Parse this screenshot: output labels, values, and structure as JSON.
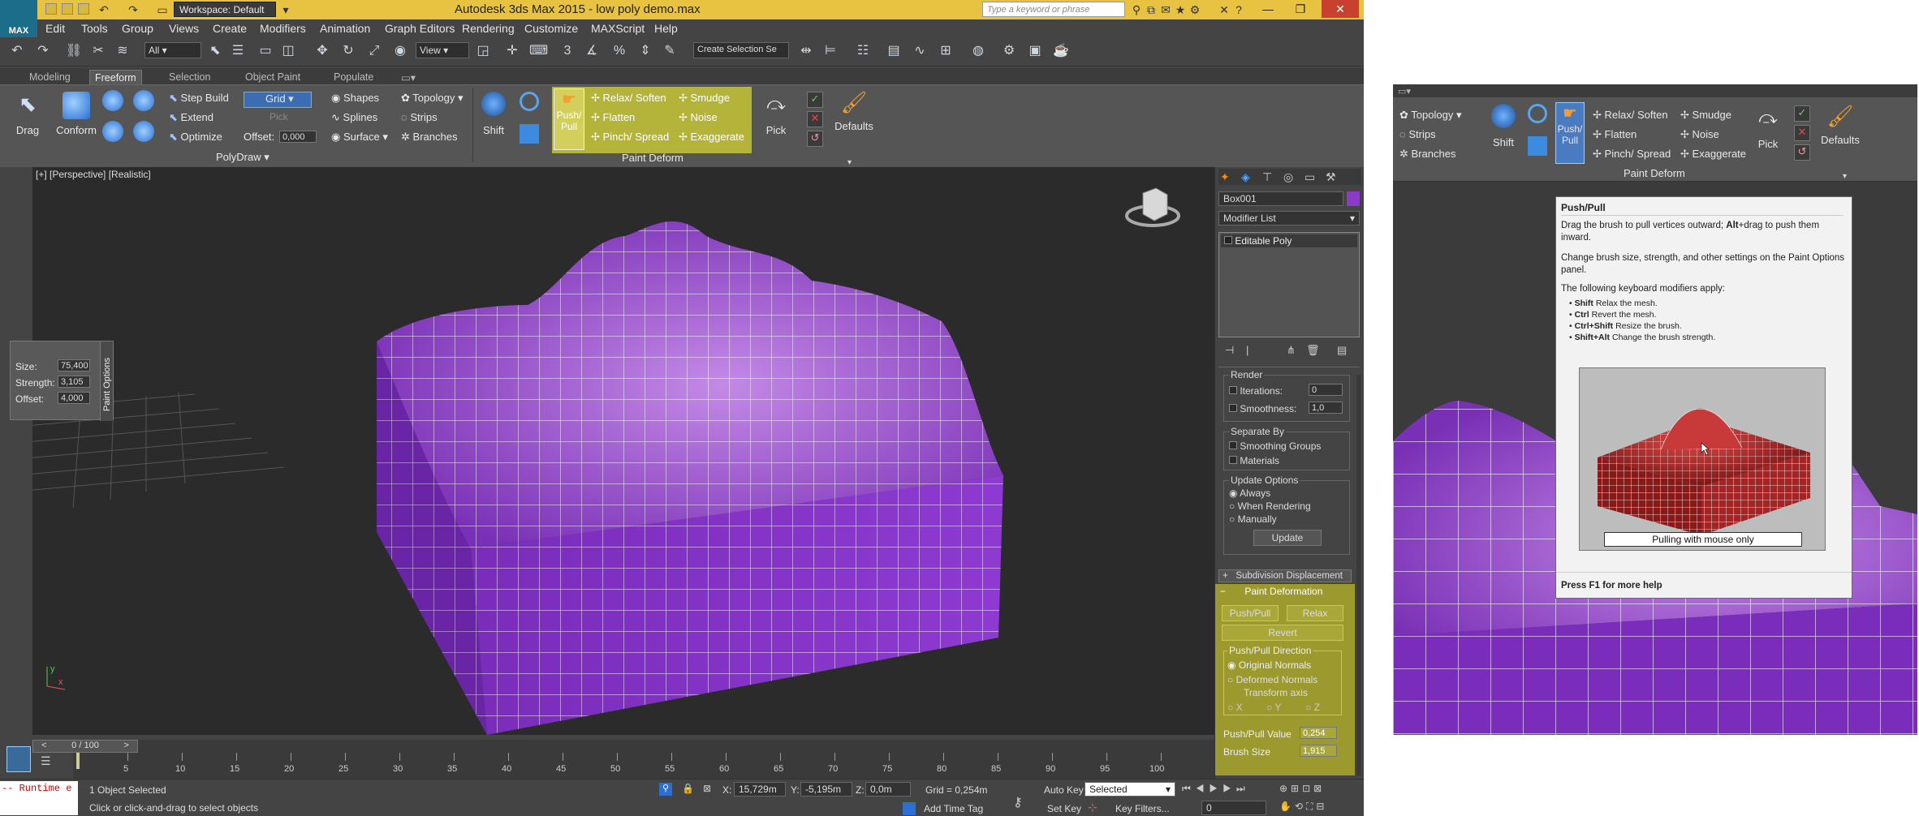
{
  "window": {
    "title": "Autodesk 3ds Max  2015  -  low poly demo.max",
    "app_logo": "MAX",
    "workspace": "Workspace: Default",
    "search_placeholder": "Type a keyword or phrase"
  },
  "menu": [
    "Edit",
    "Tools",
    "Group",
    "Views",
    "Create",
    "Modifiers",
    "Animation",
    "Graph Editors",
    "Rendering",
    "Customize",
    "MAXScript",
    "Help"
  ],
  "toolbar": {
    "filter": "All",
    "ref_coord": "View",
    "selection_set": "Create Selection Se"
  },
  "ribbon_tabs": [
    "Modeling",
    "Freeform",
    "Selection",
    "Object Paint",
    "Populate"
  ],
  "ribbon_active_tab": "Freeform",
  "ribbon": {
    "drag": "Drag",
    "conform": "Conform",
    "step_build": "Step Build",
    "extend": "Extend",
    "optimize": "Optimize",
    "grid": "Grid",
    "pick": "Pick",
    "offset_label": "Offset:",
    "offset_value": "0,000",
    "shapes": "Shapes",
    "splines": "Splines",
    "surface": "Surface",
    "topology": "Topology",
    "strips": "Strips",
    "branches": "Branches",
    "polydraw": "PolyDraw",
    "shift": "Shift",
    "push_pull": "Push/ Pull",
    "relax_soften": "Relax/ Soften",
    "flatten": "Flatten",
    "pinch_spread": "Pinch/ Spread",
    "smudge": "Smudge",
    "noise": "Noise",
    "exaggerate": "Exaggerate",
    "pick2": "Pick",
    "defaults": "Defaults",
    "paint_deform": "Paint Deform"
  },
  "viewport": {
    "label": "[+] [Perspective] [Realistic]",
    "mesh_color": "#8a3cc6",
    "axis_y": "y",
    "axis_x": "x"
  },
  "paint_options": {
    "title": "Paint Options",
    "size_label": "Size:",
    "size_value": "75,400",
    "strength_label": "Strength:",
    "strength_value": "3,105",
    "offset_label": "Offset:",
    "offset_value": "4,000"
  },
  "command_panel": {
    "object_name": "Box001",
    "object_color": "#8a3cc6",
    "modifier_list": "Modifier List",
    "stack_item": "Editable Poly",
    "render": "Render",
    "iterations_label": "Iterations:",
    "iterations_value": "0",
    "smoothness_label": "Smoothness:",
    "smoothness_value": "1,0",
    "separate_by": "Separate By",
    "smoothing_groups": "Smoothing Groups",
    "materials": "Materials",
    "update_options": "Update Options",
    "always": "Always",
    "when_rendering": "When Rendering",
    "manually": "Manually",
    "update": "Update",
    "subdiv_disp": "Subdivision Displacement",
    "paint_deformation": "Paint Deformation",
    "push_pull": "Push/Pull",
    "relax": "Relax",
    "revert": "Revert",
    "pp_direction": "Push/Pull Direction",
    "original_normals": "Original Normals",
    "deformed_normals": "Deformed Normals",
    "transform_axis": "Transform axis",
    "ax_x": "X",
    "ax_y": "Y",
    "ax_z": "Z",
    "pp_value_label": "Push/Pull Value",
    "pp_value": "0,254",
    "brush_size_label": "Brush Size",
    "brush_size": "1,915"
  },
  "timeline": {
    "frame": "0 / 100",
    "ticks": [
      "5",
      "10",
      "15",
      "20",
      "25",
      "30",
      "35",
      "40",
      "45",
      "50",
      "55",
      "60",
      "65",
      "70",
      "75",
      "80",
      "85",
      "90",
      "95",
      "100"
    ]
  },
  "status": {
    "runtime": "-- Runtime e",
    "selected": "1 Object Selected",
    "prompt": "Click or click-and-drag to select objects",
    "x_label": "X:",
    "x": "15,729m",
    "y_label": "Y:",
    "y": "-5,195m",
    "z_label": "Z:",
    "z": "0,0m",
    "grid": "Grid = 0,254m",
    "add_time_tag": "Add Time Tag",
    "auto_key": "Auto Key",
    "set_key": "Set Key",
    "selected_dd": "Selected",
    "key_filters": "Key Filters...",
    "frame_field": "0"
  },
  "tooltip": {
    "title": "Push/Pull",
    "p1a": "Drag the brush to pull vertices outward; ",
    "p1b": "Alt",
    "p1c": "+drag to push them inward.",
    "p2": "Change brush size, strength, and other settings on the Paint Options panel.",
    "p3": "The following keyboard modifiers apply:",
    "mods": [
      {
        "key": "Shift",
        "desc": "Relax the mesh."
      },
      {
        "key": "Ctrl",
        "desc": "Revert the mesh."
      },
      {
        "key": "Ctrl+Shift",
        "desc": "Resize the brush."
      },
      {
        "key": "Shift+Alt",
        "desc": "Change the brush strength."
      }
    ],
    "caption": "Pulling with mouse only",
    "footer": "Press F1 for more help"
  }
}
